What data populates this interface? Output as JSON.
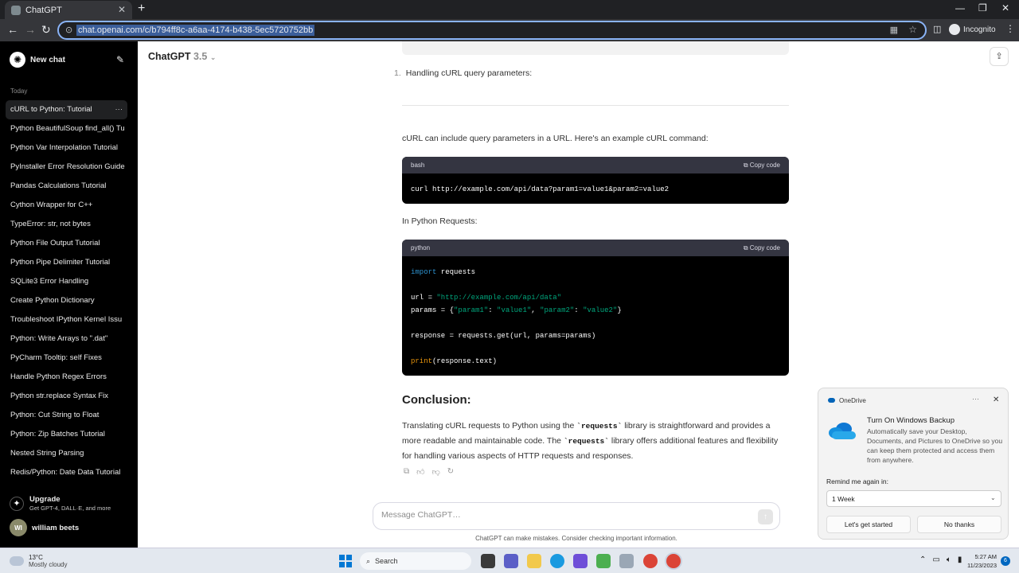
{
  "browser": {
    "tab_title": "ChatGPT",
    "url": "chat.openai.com/c/b794ff8c-a6aa-4174-b438-5ec5720752bb",
    "incognito_label": "Incognito"
  },
  "sidebar": {
    "new_chat": "New chat",
    "section": "Today",
    "items": [
      "cURL to Python: Tutorial",
      "Python BeautifulSoup find_all() Tu",
      "Python Var Interpolation Tutorial",
      "PyInstaller Error Resolution Guide",
      "Pandas Calculations Tutorial",
      "Cython Wrapper for C++",
      "TypeError: str, not bytes",
      "Python File Output Tutorial",
      "Python Pipe Delimiter Tutorial",
      "SQLite3 Error Handling",
      "Create Python Dictionary",
      "Troubleshoot IPython Kernel Issu",
      "Python: Write Arrays to \".dat\"",
      "PyCharm Tooltip: self Fixes",
      "Handle Python Regex Errors",
      "Python str.replace Syntax Fix",
      "Python: Cut String to Float",
      "Python: Zip Batches Tutorial",
      "Nested String Parsing",
      "Redis/Python: Date Data Tutorial"
    ],
    "upgrade_title": "Upgrade",
    "upgrade_sub": "Get GPT-4, DALL·E, and more",
    "user_initials": "WI",
    "user_name": "william beets"
  },
  "main": {
    "model": "ChatGPT",
    "model_version": "3.5",
    "list_number": "1.",
    "list_item": "Handling cURL query parameters:",
    "para1": "cURL can include query parameters in a URL. Here's an example cURL command:",
    "code1": {
      "lang": "bash",
      "copy": "Copy code",
      "line": "curl http://example.com/api/data?param1=value1&param2=value2"
    },
    "para2": "In Python Requests:",
    "code2": {
      "lang": "python",
      "copy": "Copy code",
      "l1_kw": "import",
      "l1_rest": " requests",
      "l2_a": "url = ",
      "l2_str": "\"http://example.com/api/data\"",
      "l3_a": "params = {",
      "l3_s1": "\"param1\"",
      "l3_b": ": ",
      "l3_s2": "\"value1\"",
      "l3_c": ", ",
      "l3_s3": "\"param2\"",
      "l3_d": ": ",
      "l3_s4": "\"value2\"",
      "l3_e": "}",
      "l4": "response = requests.get(url, params=params)",
      "l5_fn": "print",
      "l5_rest": "(response.text)"
    },
    "conclusion_heading": "Conclusion:",
    "concl_a": "Translating cURL requests to Python using the ",
    "concl_code1": "`requests`",
    "concl_b": " library is straightforward and provides a more readable and maintainable code. The ",
    "concl_code2": "`requests`",
    "concl_c": " library offers additional features and flexibility for handling various aspects of HTTP requests and responses.",
    "composer_placeholder": "Message ChatGPT…",
    "disclaimer": "ChatGPT can make mistakes. Consider checking important information."
  },
  "toast": {
    "app": "OneDrive",
    "title": "Turn On Windows Backup",
    "body": "Automatically save your Desktop, Documents, and Pictures to OneDrive so you can keep them protected and access them from anywhere.",
    "remind_label": "Remind me again in:",
    "remind_value": "1 Week",
    "primary_button": "Let's get started",
    "secondary_button": "No thanks"
  },
  "taskbar": {
    "temp": "13°C",
    "weather": "Mostly cloudy",
    "search": "Search",
    "time": "5:27 AM",
    "date": "11/23/2023",
    "notifications": "6"
  }
}
